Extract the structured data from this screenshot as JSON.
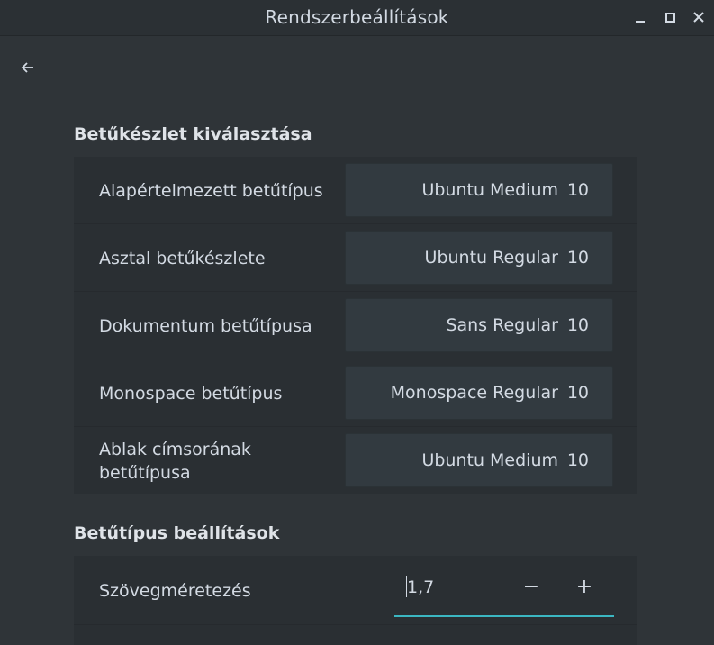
{
  "window": {
    "title": "Rendszerbeállítások",
    "controls": [
      "minimize",
      "maximize",
      "close"
    ]
  },
  "sections": {
    "fonts": {
      "title": "Betűkészlet kiválasztása",
      "rows": [
        {
          "label": "Alapértelmezett betűtípus",
          "font": "Ubuntu Medium",
          "size": "10"
        },
        {
          "label": "Asztal betűkészlete",
          "font": "Ubuntu Regular",
          "size": "10"
        },
        {
          "label": "Dokumentum betűtípusa",
          "font": "Sans Regular",
          "size": "10"
        },
        {
          "label": "Monospace betűtípus",
          "font": "Monospace Regular",
          "size": "10"
        },
        {
          "label": "Ablak címsorának betűtípusa",
          "font": "Ubuntu Medium",
          "size": "10"
        }
      ]
    },
    "settings": {
      "title": "Betűtípus beállítások",
      "text_scaling": {
        "label": "Szövegméretezés",
        "value": "1,7",
        "minus": "−",
        "plus": "+"
      }
    }
  },
  "colors": {
    "background": "#2f3438",
    "panel": "#2a2f33",
    "button": "#323a40",
    "accent": "#3bb7c2",
    "text": "#d3dae3"
  },
  "icons": {
    "back": "back-arrow-icon",
    "minimize": "minimize-icon",
    "maximize": "maximize-icon",
    "close": "close-icon"
  }
}
